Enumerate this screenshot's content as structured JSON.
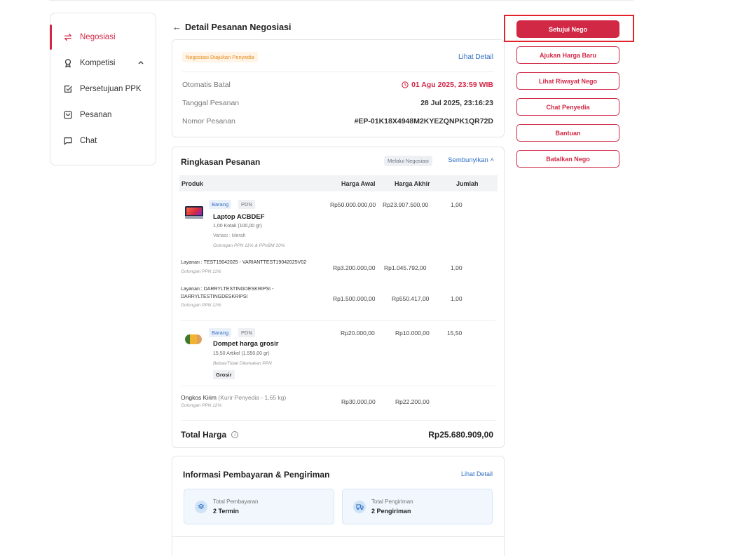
{
  "sidebar": {
    "items": [
      {
        "label": "Negosiasi",
        "icon": "swap-arrows-icon",
        "active": true
      },
      {
        "label": "Kompetisi",
        "icon": "award-ribbon-icon",
        "active": false,
        "expandable": true
      },
      {
        "label": "Persetujuan PPK",
        "icon": "checkbox-icon",
        "active": false
      },
      {
        "label": "Pesanan",
        "icon": "shopping-bag-icon",
        "active": false
      },
      {
        "label": "Chat",
        "icon": "chat-bubble-icon",
        "active": false
      }
    ]
  },
  "header": {
    "back_arrow": "←",
    "title": "Detail Pesanan Negosiasi"
  },
  "summary": {
    "status_badge": "Negosiasi Diajukan Penyedia",
    "detail_link": "Lihat Detail",
    "rows": [
      {
        "label": "Otomatis Batal",
        "value": "01 Agu 2025, 23:59 WIB",
        "icon": "clock-icon"
      },
      {
        "label": "Tanggal Pesanan",
        "value": "28 Jul 2025, 23:16:23"
      },
      {
        "label": "Nomor Pesanan",
        "value": "#EP-01K18X4948M2KYEZQNPK1QR72D"
      }
    ]
  },
  "order": {
    "title": "Ringkasan Pesanan",
    "method_badge": "Melalui Negosiasi",
    "toggle_label": "Sembunyikan",
    "columns": [
      "Produk",
      "Harga Awal",
      "Harga Akhir",
      "Jumlah"
    ],
    "items": [
      {
        "tags": [
          "Barang",
          "PDN"
        ],
        "name": "Laptop ACBDEF",
        "qty_text": "1,00 Kotak (100,00 gr)",
        "variant": "Variasi     : Merah",
        "tax": "Golongan PPN 11% & PPnBM 20%",
        "harga_awal": "Rp50.000.000,00",
        "harga_akhir": "Rp23.907.500,00",
        "jumlah": "1,00"
      },
      {
        "service": "Layanan : TEST19042025 - VARIANTTEST19042025V02",
        "tax": "Golongan PPN 11%",
        "harga_awal": "Rp3.200.000,00",
        "harga_akhir": "Rp1.045.792,00",
        "jumlah": "1,00"
      },
      {
        "service_line1": "Layanan : DARRYLTESTINGDESKRIPSI -",
        "service_line2": "DARRYLTESTINGDESKRIPSI",
        "tax": "Golongan PPN 11%",
        "harga_awal": "Rp1.500.000,00",
        "harga_akhir": "Rp550.417,00",
        "jumlah": "1,00"
      },
      {
        "tags": [
          "Barang",
          "PDN"
        ],
        "name": "Dompet harga grosir",
        "qty_text": "15,50 Artikel (1.550,00 gr)",
        "tax": "Bebas/Tidak Dikenakan PPN",
        "extra_tag": "Grosir",
        "harga_awal": "Rp20.000,00",
        "harga_akhir": "Rp10.000,00",
        "jumlah": "15,50"
      }
    ],
    "shipping": {
      "label": "Ongkos Kirim",
      "courier": "(Kurir Penyedia - 1,65 kg)",
      "tax": "Golongan PPN 12%",
      "harga_awal": "Rp30.000,00",
      "harga_akhir": "Rp22.200,00"
    },
    "total_label": "Total Harga",
    "total_value": "Rp25.680.909,00"
  },
  "payment": {
    "title": "Informasi Pembayaran & Pengiriman",
    "detail_link": "Lihat Detail",
    "boxes": [
      {
        "label": "Total Pembayaran",
        "value": "2 Termin",
        "icon": "layers-icon"
      },
      {
        "label": "Total Pengiriman",
        "value": "2 Pengiriman",
        "icon": "truck-icon"
      }
    ]
  },
  "actions": {
    "approve": "Setujui Nego",
    "new_price": "Ajukan Harga Baru",
    "history": "Lihat Riwayat Nego",
    "chat": "Chat Penyedia",
    "help": "Bantuan",
    "cancel": "Batalkan Nego"
  },
  "colors": {
    "accent": "#d12846",
    "link": "#2f6ec2",
    "badge_orange": "#e58a1d",
    "highlight": "#e2232b"
  }
}
